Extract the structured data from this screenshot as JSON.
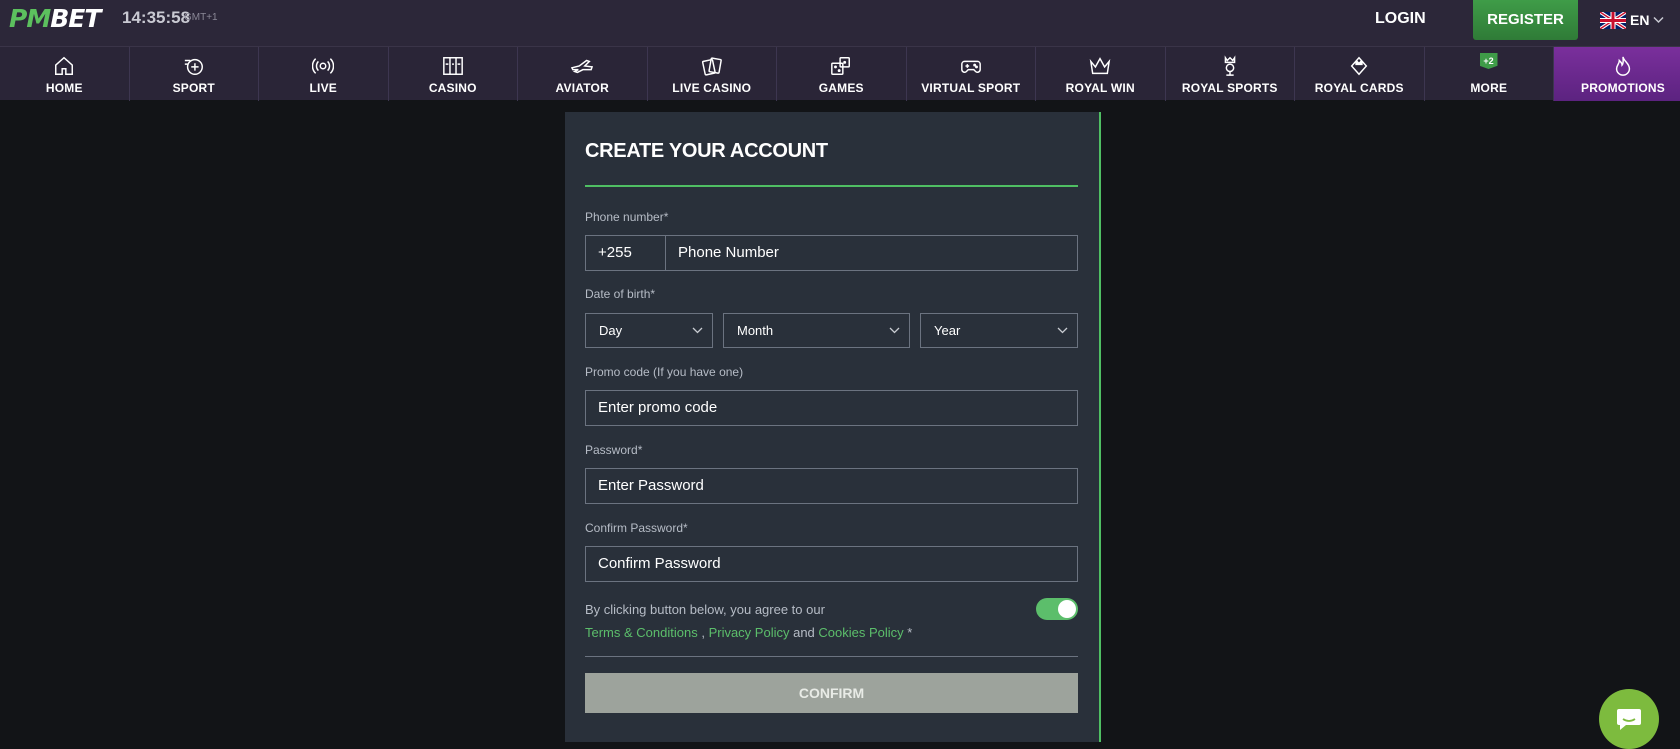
{
  "header": {
    "logo_main": "BET",
    "logo_prefix": "PM",
    "time": "14:35:58",
    "timezone": "GMT+1",
    "login_label": "LOGIN",
    "register_label": "REGISTER",
    "language": "EN"
  },
  "nav": {
    "items": [
      {
        "label": "HOME",
        "icon": "home-icon"
      },
      {
        "label": "SPORT",
        "icon": "sport-icon"
      },
      {
        "label": "LIVE",
        "icon": "live-icon"
      },
      {
        "label": "CASINO",
        "icon": "casino-icon"
      },
      {
        "label": "AVIATOR",
        "icon": "aviator-icon"
      },
      {
        "label": "LIVE CASINO",
        "icon": "live-casino-icon"
      },
      {
        "label": "GAMES",
        "icon": "games-icon"
      },
      {
        "label": "VIRTUAL SPORT",
        "icon": "virtual-sport-icon"
      },
      {
        "label": "ROYAL WIN",
        "icon": "crown-icon"
      },
      {
        "label": "ROYAL SPORTS",
        "icon": "royal-sports-icon"
      },
      {
        "label": "ROYAL CARDS",
        "icon": "royal-cards-icon"
      },
      {
        "label": "MORE",
        "icon": "more-icon",
        "badge": "+2"
      },
      {
        "label": "PROMOTIONS",
        "icon": "flame-icon"
      }
    ]
  },
  "form": {
    "title": "CREATE YOUR ACCOUNT",
    "phone_label": "Phone number*",
    "phone_code": "+255",
    "phone_placeholder": "Phone Number",
    "dob_label": "Date of birth*",
    "day": "Day",
    "month": "Month",
    "year": "Year",
    "promo_label": "Promo code (If you have one)",
    "promo_placeholder": "Enter promo code",
    "password_label": "Password*",
    "password_placeholder": "Enter Password",
    "confirm_label": "Confirm Password*",
    "confirm_placeholder": "Confirm Password",
    "agree_text": "By clicking button below, you agree to our",
    "terms": "Terms & Conditions",
    "comma": " , ",
    "privacy": "Privacy Policy",
    "and": " and ",
    "cookies": "Cookies Policy",
    "asterisk": " *",
    "confirm_button": "CONFIRM",
    "agree_toggle_on": true
  },
  "colors": {
    "accent": "#4fbf63",
    "header_bg": "#2c2739",
    "promo_bg": "#7a2f9c",
    "panel_bg": "#29303a",
    "chat_bg": "#7dbb3e"
  }
}
